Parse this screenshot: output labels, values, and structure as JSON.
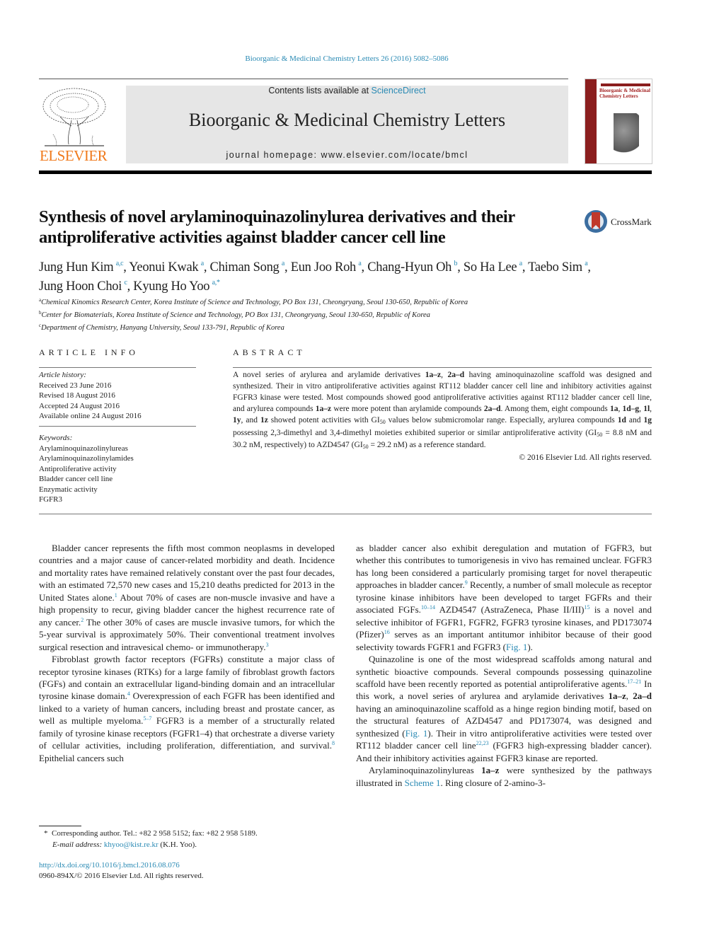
{
  "citation": "Bioorganic & Medicinal Chemistry Letters 26 (2016) 5082–5086",
  "header": {
    "publisher_logo_text": "ELSEVIER",
    "contents_prefix": "Contents lists available at ",
    "contents_link": "ScienceDirect",
    "journal_title": "Bioorganic & Medicinal Chemistry Letters",
    "homepage": "journal homepage: www.elsevier.com/locate/bmcl",
    "cover_title": "Bioorganic & Medicinal Chemistry Letters"
  },
  "article": {
    "title": "Synthesis of novel arylaminoquinazolinylurea derivatives and their antiproliferative activities against bladder cancer cell line",
    "crossmark_label": "CrossMark",
    "authors": [
      {
        "name": "Jung Hun Kim",
        "aff": "a,c",
        "sep": ", "
      },
      {
        "name": "Yeonui Kwak",
        "aff": "a",
        "sep": ", "
      },
      {
        "name": "Chiman Song",
        "aff": "a",
        "sep": ", "
      },
      {
        "name": "Eun Joo Roh",
        "aff": "a",
        "sep": ", "
      },
      {
        "name": "Chang-Hyun Oh",
        "aff": "b",
        "sep": ", "
      },
      {
        "name": "So Ha Lee",
        "aff": "a",
        "sep": ", "
      },
      {
        "name": "Taebo Sim",
        "aff": "a",
        "sep": ","
      },
      {
        "name": "Jung Hoon Choi",
        "aff": "c",
        "sep": ", "
      },
      {
        "name": "Kyung Ho Yoo",
        "aff": "a,*",
        "sep": ""
      }
    ],
    "affiliations": [
      {
        "key": "a",
        "text": "Chemical Kinomics Research Center, Korea Institute of Science and Technology, PO Box 131, Cheongryang, Seoul 130-650, Republic of Korea"
      },
      {
        "key": "b",
        "text": "Center for Biomaterials, Korea Institute of Science and Technology, PO Box 131, Cheongryang, Seoul 130-650, Republic of Korea"
      },
      {
        "key": "c",
        "text": "Department of Chemistry, Hanyang University, Seoul 133-791, Republic of Korea"
      }
    ]
  },
  "article_info": {
    "heading": "ARTICLE INFO",
    "history_label": "Article history:",
    "history": [
      "Received 23 June 2016",
      "Revised 18 August 2016",
      "Accepted 24 August 2016",
      "Available online 24 August 2016"
    ],
    "keywords_label": "Keywords:",
    "keywords": [
      "Arylaminoquinazolinylureas",
      "Arylaminoquinazolinylamides",
      "Antiproliferative activity",
      "Bladder cancer cell line",
      "Enzymatic activity",
      "FGFR3"
    ]
  },
  "abstract": {
    "heading": "ABSTRACT",
    "html": "A novel series of arylurea and arylamide derivatives <b>1a–z</b>, <b>2a–d</b> having aminoquinazoline scaffold was designed and synthesized. Their in vitro antiproliferative activities against RT112 bladder cancer cell line and inhibitory activities against FGFR3 kinase were tested. Most compounds showed good antiproliferative activities against RT112 bladder cancer cell line, and arylurea compounds <b>1a–z</b> were more potent than arylamide compounds <b>2a–d</b>. Among them, eight compounds <b>1a</b>, <b>1d–g</b>, <b>1l</b>, <b>1y</b>, and <b>1z</b> showed potent activities with GI<sub>50</sub> values below submicromolar range. Especially, arylurea compounds <b>1d</b> and <b>1g</b> possessing 2,3-dimethyl and 3,4-dimethyl moieties exhibited superior or similar antiproliferative activity (GI<sub>50</sub> = 8.8 nM and 30.2 nM, respectively) to AZD4547 (GI<sub>50</sub> = 29.2 nM) as a reference standard.",
    "copyright": "© 2016 Elsevier Ltd. All rights reserved."
  },
  "body": {
    "left": [
      "Bladder cancer represents the fifth most common neoplasms in developed countries and a major cause of cancer-related morbidity and death. Incidence and mortality rates have remained relatively constant over the past four decades, with an estimated 72,570 new cases and 15,210 deaths predicted for 2013 in the United States alone.<sup>1</sup> About 70% of cases are non-muscle invasive and have a high propensity to recur, giving bladder cancer the highest recurrence rate of any cancer.<sup>2</sup> The other 30% of cases are muscle invasive tumors, for which the 5-year survival is approximately 50%. Their conventional treatment involves surgical resection and intravesical chemo- or immunotherapy.<sup>3</sup>",
      "Fibroblast growth factor receptors (FGFRs) constitute a major class of receptor tyrosine kinases (RTKs) for a large family of fibroblast growth factors (FGFs) and contain an extracellular ligand-binding domain and an intracellular tyrosine kinase domain.<sup>4</sup> Overexpression of each FGFR has been identified and linked to a variety of human cancers, including breast and prostate cancer, as well as multiple myeloma.<sup>5–7</sup> FGFR3 is a member of a structurally related family of tyrosine kinase receptors (FGFR1–4) that orchestrate a diverse variety of cellular activities, including proliferation, differentiation, and survival.<sup>8</sup> Epithelial cancers such"
    ],
    "right": [
      "as bladder cancer also exhibit deregulation and mutation of FGFR3, but whether this contributes to tumorigenesis in vivo has remained unclear. FGFR3 has long been considered a particularly promising target for novel therapeutic approaches in bladder cancer.<sup>9</sup> Recently, a number of small molecule as receptor tyrosine kinase inhibitors have been developed to target FGFRs and their associated FGFs.<sup>10–14</sup> AZD4547 (AstraZeneca, Phase II/III)<sup>15</sup> is a novel and selective inhibitor of FGFR1, FGFR2, FGFR3 tyrosine kinases, and PD173074 (Pfizer)<sup>16</sup> serves as an important antitumor inhibitor because of their good selectivity towards FGFR1 and FGFR3 (<span class=\"link\">Fig. 1</span>).",
      "Quinazoline is one of the most widespread scaffolds among natural and synthetic bioactive compounds. Several compounds possessing quinazoline scaffold have been recently reported as potential antiproliferative agents.<sup>17–21</sup> In this work, a novel series of arylurea and arylamide derivatives <b>1a–z</b>, <b>2a–d</b> having an aminoquinazoline scaffold as a hinge region binding motif, based on the structural features of AZD4547 and PD173074, was designed and synthesized (<span class=\"link\">Fig. 1</span>). Their in vitro antiproliferative activities were tested over RT112 bladder cancer cell line<sup>22,23</sup> (FGFR3 high-expressing bladder cancer). And their inhibitory activities against FGFR3 kinase are reported.",
      "Arylaminoquinazolinylureas <b>1a–z</b> were synthesized by the pathways illustrated in <span class=\"link\">Scheme 1</span>. Ring closure of 2-amino-3-"
    ]
  },
  "footnote": {
    "marker": "*",
    "text": "Corresponding author. Tel.: +82 2 958 5152; fax: +82 2 958 5189.",
    "email_label": "E-mail address:",
    "email": "khyoo@kist.re.kr",
    "email_suffix": " (K.H. Yoo)."
  },
  "doi": {
    "url": "http://dx.doi.org/10.1016/j.bmcl.2016.08.076",
    "issn": "0960-894X/© 2016 Elsevier Ltd. All rights reserved."
  }
}
